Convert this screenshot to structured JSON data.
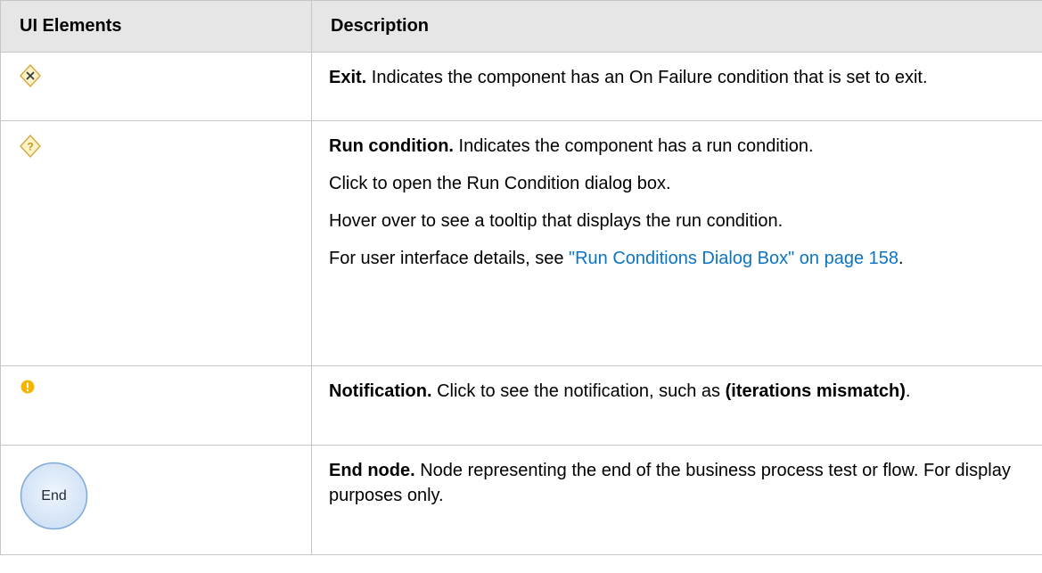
{
  "table": {
    "headers": [
      "UI Elements",
      "Description"
    ],
    "rows": [
      {
        "icon": "exit-diamond-icon",
        "paragraphs": [
          {
            "bold": "Exit.",
            "text": " Indicates the component has an On Failure condition that is set to exit."
          }
        ]
      },
      {
        "icon": "run-condition-diamond-icon",
        "paragraphs": [
          {
            "bold": "Run condition.",
            "text": " Indicates the component has a run condition."
          },
          {
            "text": "Click to open the Run Condition dialog box."
          },
          {
            "text": "Hover over to see a tooltip that displays the run condition."
          },
          {
            "text": "For user interface details, see ",
            "link": "\"Run Conditions Dialog Box\" on page 158",
            "after": "."
          }
        ]
      },
      {
        "icon": "notification-info-icon",
        "paragraphs": [
          {
            "bold": "Notification.",
            "text": " Click to see the notification, such as ",
            "bold2": "(iterations mismatch)",
            "after": "."
          }
        ]
      },
      {
        "icon": "end-node-icon",
        "icon_label": "End",
        "paragraphs": [
          {
            "bold": "End node.",
            "text": " Node representing the end of the business process test or flow. For display purposes only."
          }
        ]
      }
    ]
  },
  "colors": {
    "header_bg": "#e6e6e6",
    "border": "#c6c6c6",
    "link": "#0b74c4",
    "diamond_fill": "#fdf3c8",
    "diamond_stroke": "#d8a640",
    "notification": "#f5b400",
    "end_node_fill": "#d4e5f7",
    "end_node_stroke": "#7fa9d6"
  }
}
